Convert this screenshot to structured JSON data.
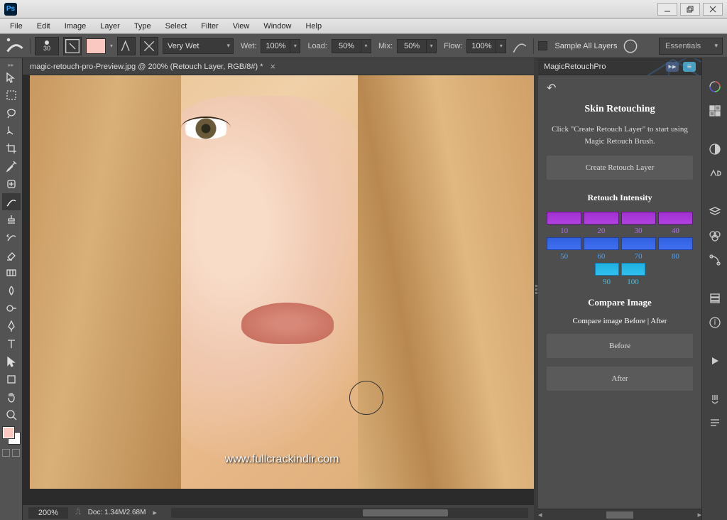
{
  "app": {
    "logo": "Ps"
  },
  "window_controls": {
    "minimize": "—",
    "restore": "❐",
    "close": "✕"
  },
  "menus": [
    "File",
    "Edit",
    "Image",
    "Layer",
    "Type",
    "Select",
    "Filter",
    "View",
    "Window",
    "Help"
  ],
  "options": {
    "brush_size": "30",
    "preset": "Very Wet",
    "wet_label": "Wet:",
    "wet_value": "100%",
    "load_label": "Load:",
    "load_value": "50%",
    "mix_label": "Mix:",
    "mix_value": "50%",
    "flow_label": "Flow:",
    "flow_value": "100%",
    "sample_all_label": "Sample All Layers",
    "workspace": "Essentials"
  },
  "document": {
    "tab_title": "magic-retouch-pro-Preview.jpg @ 200% (Retouch Layer, RGB/8#) *",
    "watermark": "www.fullcrackindir.com"
  },
  "status": {
    "zoom": "200%",
    "doc_info": "Doc: 1.34M/2.68M"
  },
  "panel": {
    "tab": "MagicRetouchPro",
    "heading": "Skin Retouching",
    "description": "Click \"Create Retouch Layer\" to start using Magic Retouch Brush.",
    "create_btn": "Create Retouch Layer",
    "intensity_heading": "Retouch Intensity",
    "intensity_row1": [
      "10",
      "20",
      "30",
      "40"
    ],
    "intensity_row2": [
      "50",
      "60",
      "70",
      "80"
    ],
    "intensity_row3": [
      "90",
      "100"
    ],
    "compare_heading": "Compare Image",
    "compare_text": "Compare image Before | After",
    "before_btn": "Before",
    "after_btn": "After"
  },
  "colors": {
    "fg": "#fac8c0",
    "bg": "#ffffff"
  }
}
